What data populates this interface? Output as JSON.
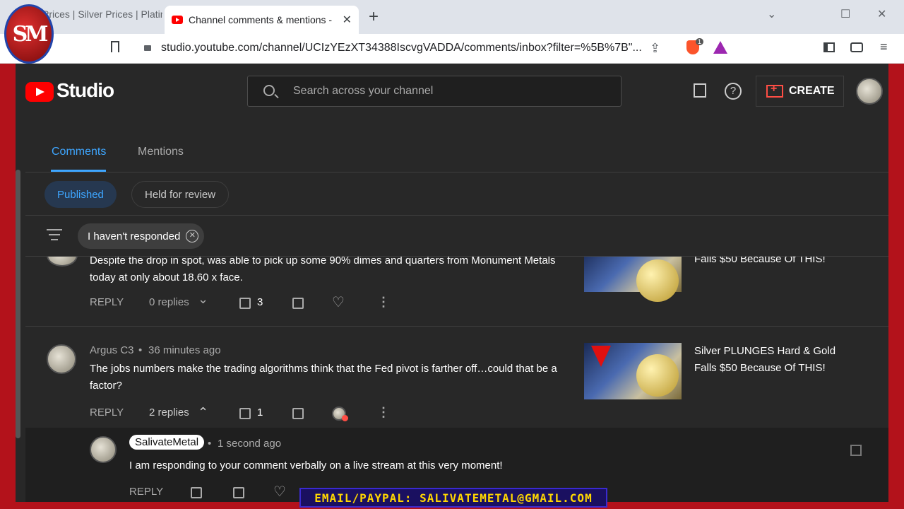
{
  "browser": {
    "inactive_tab": "Prices | Silver Prices | Platin",
    "active_tab": "Channel comments & mentions -",
    "url": "studio.youtube.com/channel/UCIzYEzXT34388IscvgVADDA/comments/inbox?filter=%5B%7B\"...",
    "brave_badge": "1"
  },
  "header": {
    "logo_text": "Studio",
    "search_placeholder": "Search across your channel",
    "help_glyph": "?",
    "create_label": "CREATE"
  },
  "tabs": {
    "comments": "Comments",
    "mentions": "Mentions"
  },
  "filters": {
    "published": "Published",
    "held": "Held for review",
    "chip": "I haven't responded",
    "chip_close": "✕"
  },
  "comments": [
    {
      "text_line1": "Despite the drop in spot, was able to pick up some 90% dimes and quarters from Monument Metals",
      "text_line2": "today at only about 18.60 x face.",
      "reply_label": "REPLY",
      "replies": "0 replies",
      "likes": "3",
      "video_title_line": "Falls $50 Because Of THIS!"
    },
    {
      "author": "Argus C3",
      "time": "36 minutes ago",
      "text_line1": "The jobs numbers make the trading algorithms think that the Fed pivot is farther off…could that be a",
      "text_line2": "factor?",
      "reply_label": "REPLY",
      "replies": "2 replies",
      "likes": "1",
      "video_title_line1": "Silver PLUNGES Hard & Gold",
      "video_title_line2": "Falls $50 Because Of THIS!"
    }
  ],
  "reply": {
    "author": "SalivateMetal",
    "time": "1 second ago",
    "text": "I am responding to your comment verbally on a live stream at this very moment!",
    "reply_label": "REPLY"
  },
  "overlay": {
    "logo_text": "SM",
    "banner": "EMAIL/PAYPAL: SALIVATEMETAL@GMAIL.COM"
  },
  "glyphs": {
    "dot": "•",
    "chevron_down": "⌄",
    "chevron_up": "⌃",
    "heart": "♡",
    "more": "⋮",
    "close": "✕",
    "plus": "+",
    "minimize": "⌄",
    "maximize": "☐",
    "share": "⇪",
    "menu": "≡"
  },
  "colors": {
    "accent": "#3ea6ff",
    "brand_red": "#ff0000",
    "frame_red": "#b3121b",
    "background": "#282828"
  }
}
